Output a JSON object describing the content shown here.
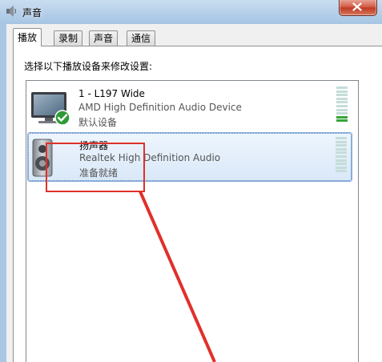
{
  "window": {
    "title": "声音",
    "icon": "speaker-icon"
  },
  "tabs": [
    {
      "label": "播放",
      "active": true
    },
    {
      "label": "录制",
      "active": false
    },
    {
      "label": "声音",
      "active": false
    },
    {
      "label": "通信",
      "active": false
    }
  ],
  "playback": {
    "instruction": "选择以下播放设备来修改设置:",
    "devices": [
      {
        "name": "1 - L197 Wide",
        "description": "AMD High Definition Audio Device",
        "status": "默认设备",
        "icon": "monitor-icon",
        "default_badge": "check-badge-icon",
        "selected": false,
        "level": 0.2
      },
      {
        "name": "扬声器",
        "description": "Realtek High Definition Audio",
        "status": "准备就绪",
        "icon": "speaker-device-icon",
        "selected": true,
        "level": 0
      }
    ]
  },
  "annotation": {
    "color": "#e0302a"
  }
}
